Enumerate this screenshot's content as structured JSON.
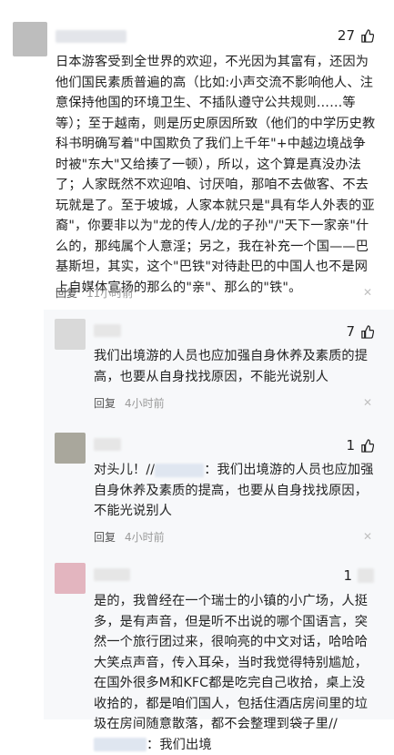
{
  "colors": {
    "accent": "#3a66b0",
    "meta_gray": "#9a9a9a",
    "reply_bg": "#f7f8fa"
  },
  "comments": [
    {
      "likes": "27",
      "avatar_color": "#bdbdbd",
      "text": "日本游客受到全世界的欢迎，不光因为其富有，还因为他们国民素质普遍的高（比如:小声交流不影响他人、注意保持他国的环境卫生、不插队遵守公共规则……等等）；至于越南，则是历史原因所致（他们的中学历史教科书明确写着\"中国欺负了我们上千年\"+中越边境战争时被\"东大\"又给揍了一顿），所以，这个算是真没办法了；人家既然不欢迎咱、讨厌咱，那咱不去做客、不去玩就是了。至于坡城，人家本就只是\"具有华人外表的亚裔\"，你要非以为\"龙的传人/龙的子孙\"/\"天下一家亲\"什么的，那纯属个人意淫；另之，我在补充一个国——巴基斯坦，其实，这个\"巴铁\"对待赴巴的中国人也不是网上自媒体宣扬的那么的\"亲\"、那么的\"铁\"。",
      "reply_label": "回复",
      "time": "11小时前"
    },
    {
      "likes": "7",
      "avatar_color": "#d9d9d9",
      "text": "我们出境游的人员也应加强自身休养及素质的提高，也要从自身找找原因，不能光说别人",
      "reply_label": "回复",
      "time": "4小时前"
    },
    {
      "likes": "1",
      "avatar_color": "#a9a79c",
      "text_prefix": "对头儿！//",
      "text_suffix": "：我们出境游的人员也应加强自身休养及素质的提高，也要从自身找找原因，不能光说别人",
      "reply_label": "回复",
      "time": "4小时前"
    },
    {
      "likes": "1",
      "avatar_color": "#e3b5bf",
      "text": "是的，我曾经在一个瑞士的小镇的小广场，人挺多，是有声音，但是听不出说的哪个国语言，突然一个旅行团过来，很响亮的中文对话，哈哈哈大笑点声音，传入耳朵，当时我觉得特别尴尬，在国外很多M和KFC都是吃完自己收拾，桌上没收拾的，都是咱们国人，包括住酒店房间里的垃圾在房间随意散落，都不会整理到袋子里//",
      "text_suffix": "：我们出境"
    }
  ]
}
